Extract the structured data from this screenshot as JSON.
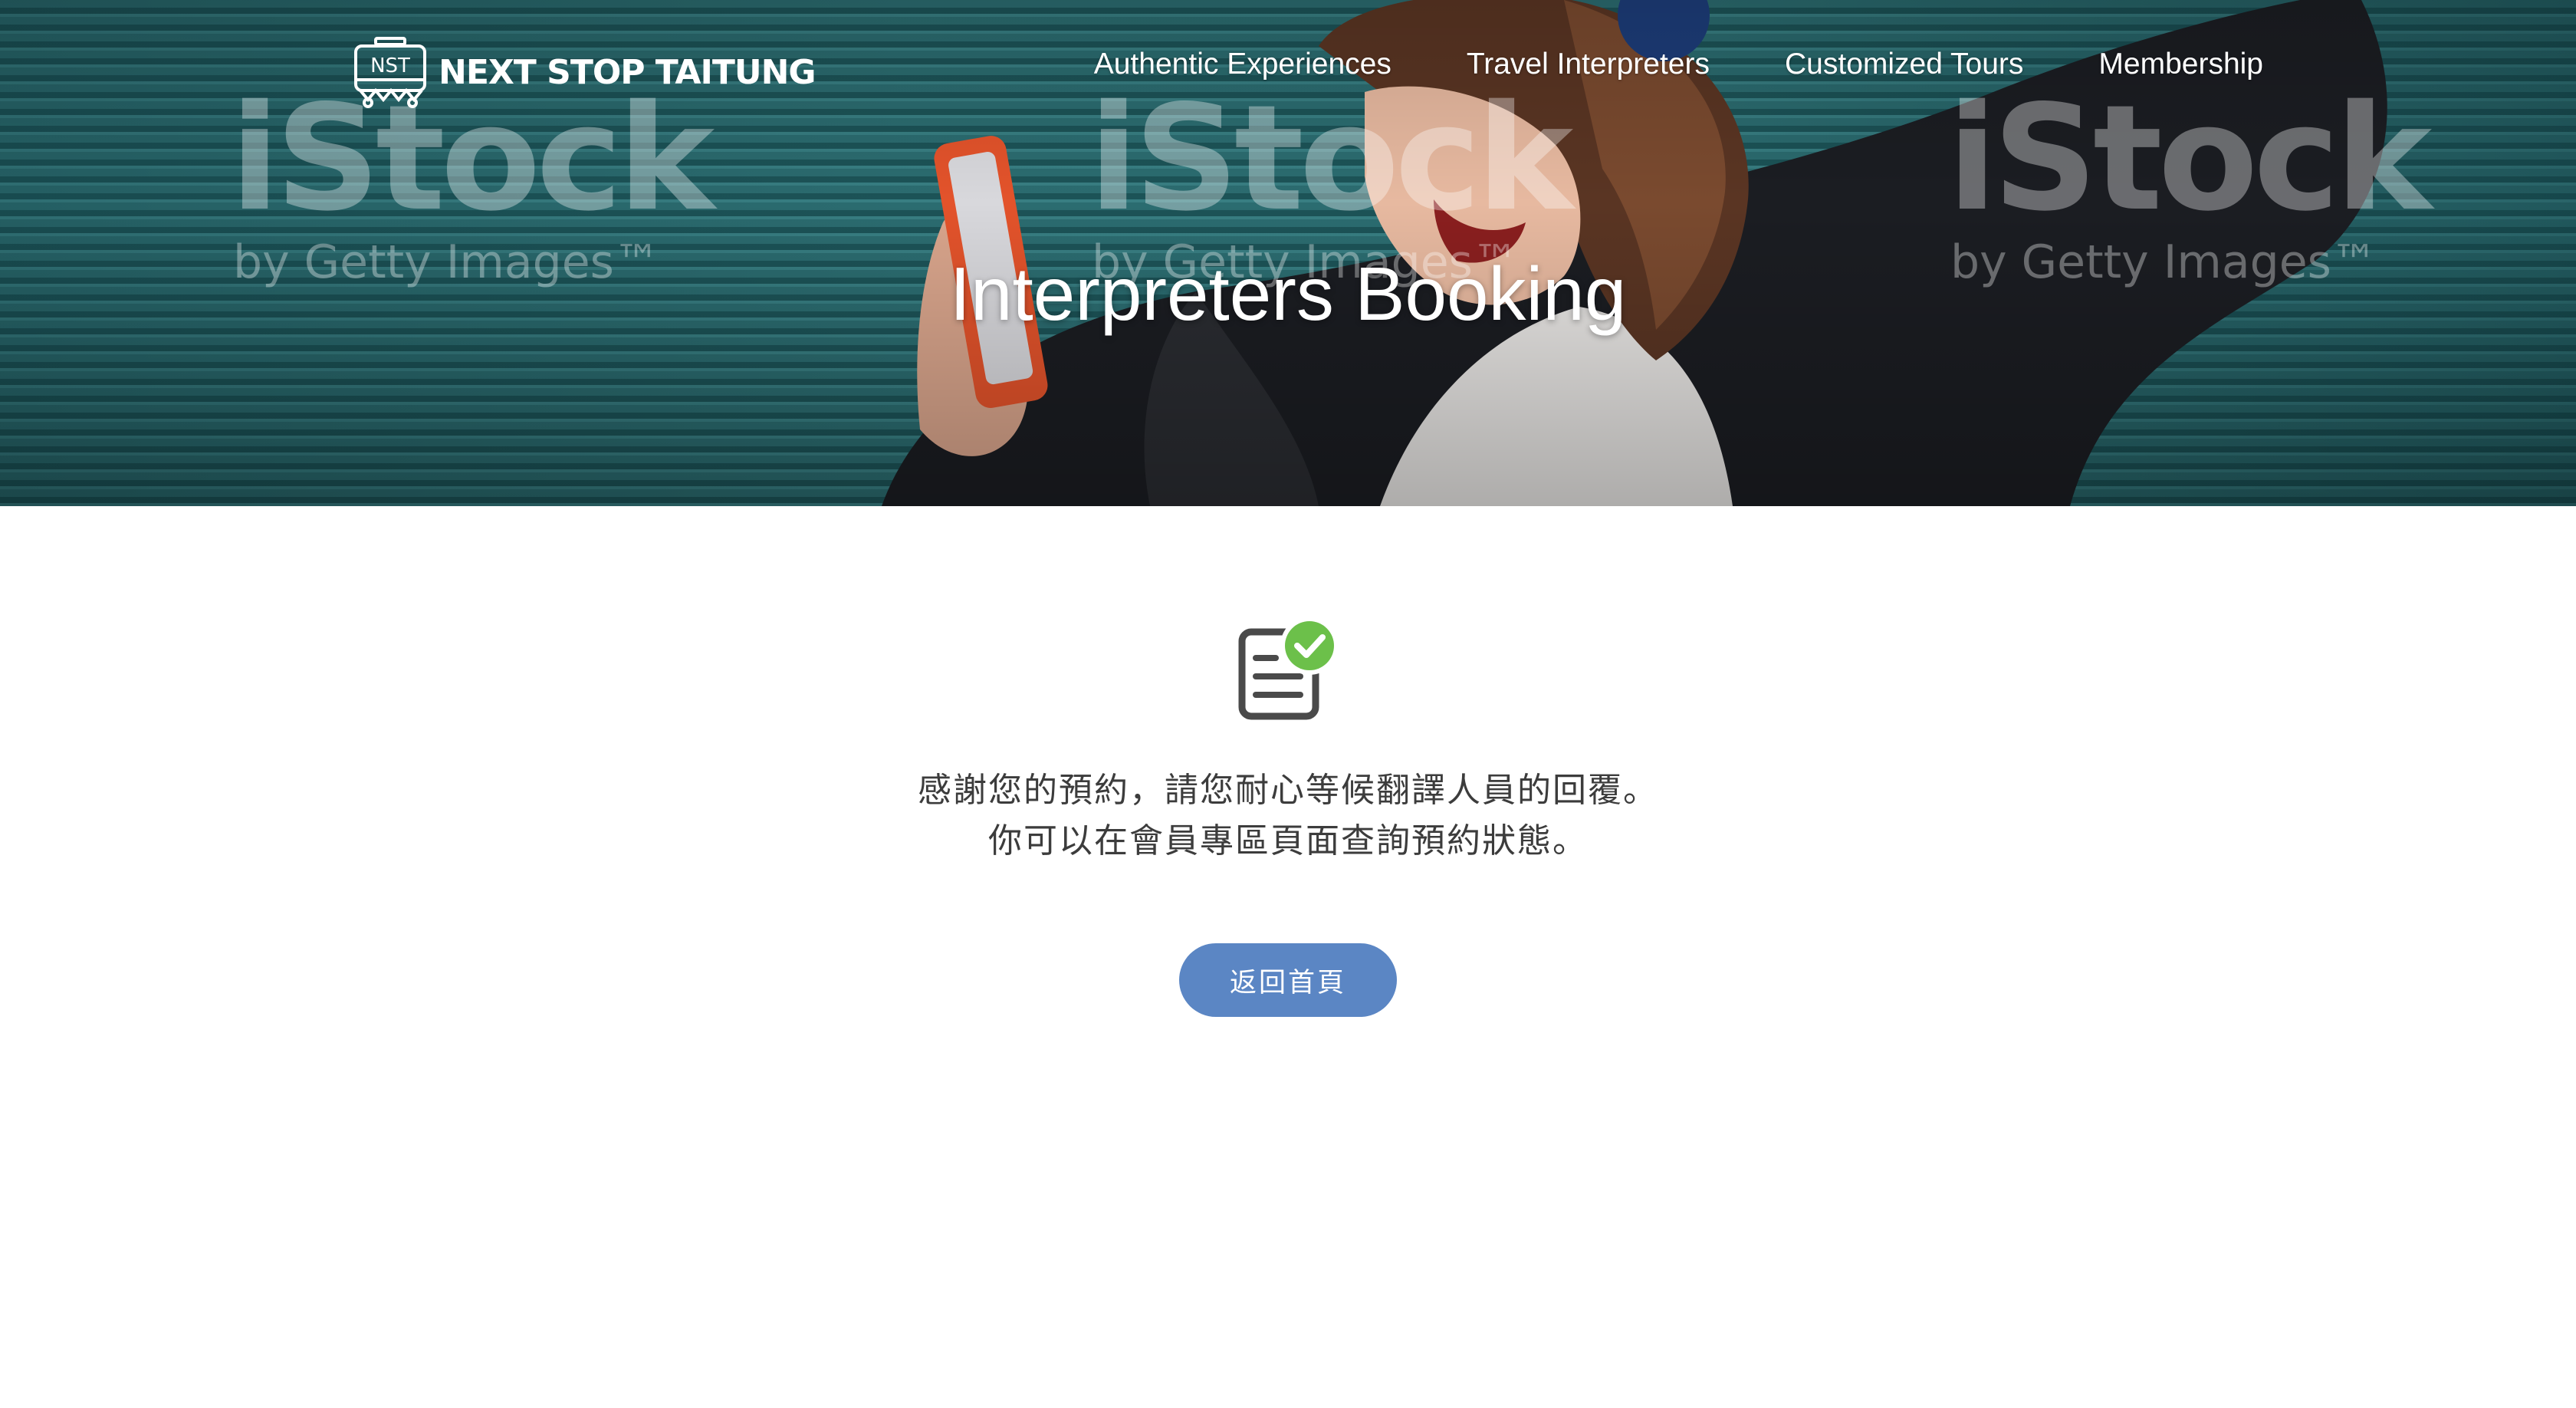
{
  "brand": {
    "badge_text": "NST",
    "name": "NEXT STOP TAITUNG"
  },
  "nav": {
    "items": [
      {
        "label": "Authentic Experiences"
      },
      {
        "label": "Travel Interpreters"
      },
      {
        "label": "Customized Tours"
      },
      {
        "label": "Membership"
      }
    ]
  },
  "hero": {
    "title": "Interpreters Booking",
    "watermark": {
      "brand": "iStock",
      "byline": "by Getty Images™"
    }
  },
  "confirmation": {
    "icon": "document-check-icon",
    "line1": "感謝您的預約，請您耐心等候翻譯人員的回覆。",
    "line2": "你可以在會員專區頁面查詢預約狀態。",
    "home_button": "返回首頁"
  },
  "colors": {
    "button": "#5b86c4",
    "check": "#6cc04a",
    "hero_teal": "#2d6f73"
  }
}
